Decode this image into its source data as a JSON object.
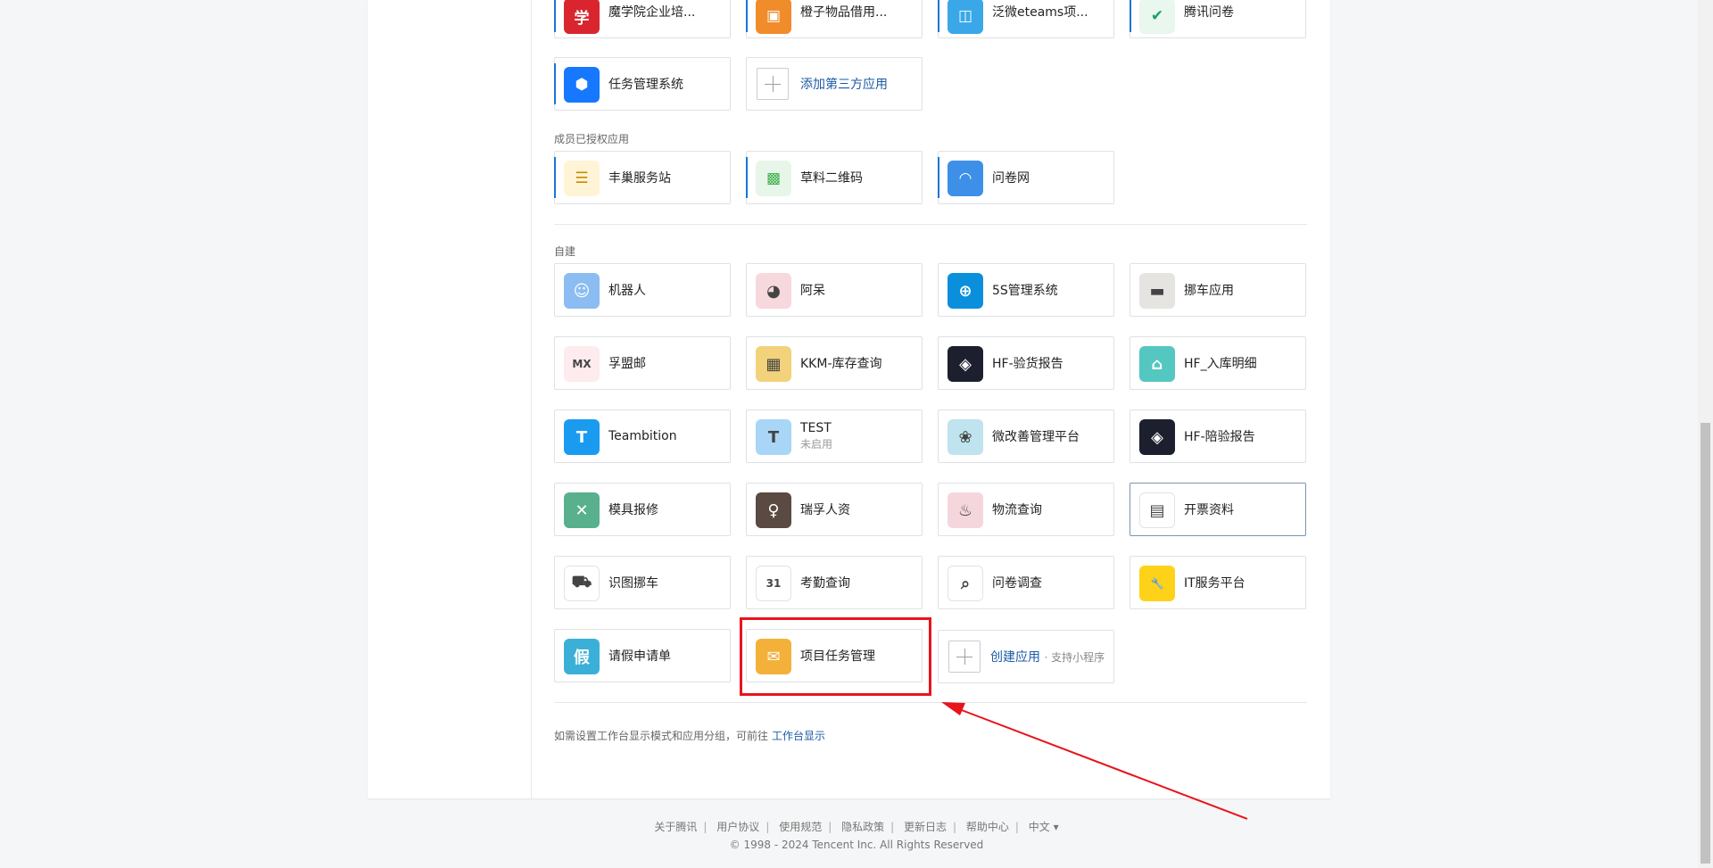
{
  "top_apps": [
    {
      "label": "魔学院企业培...",
      "icon": "mxy-icon",
      "color": "#d9262e"
    },
    {
      "label": "橙子物品借用...",
      "icon": "box-icon",
      "color": "#f08c2a"
    },
    {
      "label": "泛微eteams项...",
      "icon": "eteams-icon",
      "color": "#3aa8e8"
    },
    {
      "label": "腾讯问卷",
      "icon": "check-icon",
      "color": "#19a15f"
    }
  ],
  "task_app": {
    "label": "任务管理系统",
    "icon": "cube-icon",
    "color": "#1677ff"
  },
  "add_third_party": {
    "label": "添加第三方应用"
  },
  "authorized_title": "成员已授权应用",
  "authorized_apps": [
    {
      "label": "丰巢服务站",
      "icon": "hive-icon",
      "color": "#f4b400"
    },
    {
      "label": "草料二维码",
      "icon": "qrcode-icon",
      "color": "#3db04a"
    },
    {
      "label": "问卷网",
      "icon": "bunny-icon",
      "color": "#3d8fe8"
    }
  ],
  "custom_title": "自建",
  "custom_apps": [
    {
      "label": "机器人",
      "icon": "robot-icon",
      "color": "#8bbcf2",
      "glyph": "☺"
    },
    {
      "label": "阿呆",
      "icon": "pig-icon",
      "color": "#f6d8dd",
      "glyph": "◕"
    },
    {
      "label": "5S管理系统",
      "icon": "globe-icon",
      "color": "#0a8fdc",
      "glyph": "⊕"
    },
    {
      "label": "挪车应用",
      "icon": "car-icon",
      "color": "#e6e4e1",
      "glyph": "▬"
    },
    {
      "label": "孚盟邮",
      "icon": "fumeng-icon",
      "color": "#fdebee",
      "glyph": "MX"
    },
    {
      "label": "KKM-库存查询",
      "icon": "chip-icon",
      "color": "#f2d27a",
      "glyph": "▦"
    },
    {
      "label": "HF-验货报告",
      "icon": "dropbox-icon",
      "color": "#1b1f2e",
      "glyph": "◈"
    },
    {
      "label": "HF_入库明细",
      "icon": "home-icon",
      "color": "#54c7c1",
      "glyph": "⌂"
    },
    {
      "label": "Teambition",
      "icon": "teambition-icon",
      "color": "#1a9bf0",
      "glyph": "T"
    },
    {
      "label": "TEST",
      "sub": "未启用",
      "icon": "teambition-disabled-icon",
      "color": "#a9d6f7",
      "glyph": "T"
    },
    {
      "label": "微改善管理平台",
      "icon": "dragon-icon",
      "color": "#bfe3ef",
      "glyph": "❀"
    },
    {
      "label": "HF-陪验报告",
      "icon": "dropbox-icon",
      "color": "#1b1f2e",
      "glyph": "◈"
    },
    {
      "label": "模具报修",
      "icon": "tools-icon",
      "color": "#58b08d",
      "glyph": "✕"
    },
    {
      "label": "瑞孚人资",
      "icon": "person-photo-icon",
      "color": "#5a4a42",
      "glyph": "♀"
    },
    {
      "label": "物流查询",
      "icon": "bottle-icon",
      "color": "#f5d6dc",
      "glyph": "♨"
    },
    {
      "label": "开票资料",
      "icon": "printer-icon",
      "color": "#ffffff",
      "glyph": "▤"
    },
    {
      "label": "识图挪车",
      "icon": "car-scan-icon",
      "color": "#ffffff",
      "glyph": "⛟"
    },
    {
      "label": "考勤查询",
      "icon": "calendar-check-icon",
      "color": "#ffffff",
      "glyph": "31"
    },
    {
      "label": "问卷调查",
      "icon": "doc-search-icon",
      "color": "#ffffff",
      "glyph": "⌕"
    },
    {
      "label": "IT服务平台",
      "icon": "wrench-badge-icon",
      "color": "#ffd21a",
      "glyph": "🔧"
    },
    {
      "label": "请假申请单",
      "icon": "leave-doc-icon",
      "color": "#3ab0d8",
      "glyph": "假"
    },
    {
      "label": "项目任务管理",
      "icon": "mail-folder-icon",
      "color": "#f3b13a",
      "glyph": "✉"
    }
  ],
  "create_app": {
    "label": "创建应用",
    "hint": "· 支持小程序"
  },
  "note": {
    "text": "如需设置工作台显示模式和应用分组，可前往",
    "link": "工作台显示"
  },
  "footer": {
    "links": [
      "关于腾讯",
      "用户协议",
      "使用规范",
      "隐私政策",
      "更新日志",
      "帮助中心"
    ],
    "language": "中文 ▾",
    "copyright": "© 1998 - 2024 Tencent Inc. All Rights Reserved"
  },
  "colors": {
    "accent": "#1677d2",
    "link": "#1d5aa6",
    "annotation": "#e8141c"
  }
}
